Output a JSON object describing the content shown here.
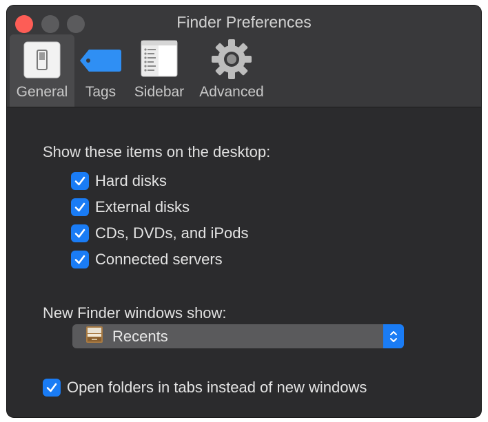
{
  "window": {
    "title": "Finder Preferences"
  },
  "toolbar": {
    "tabs": [
      {
        "label": "General",
        "icon": "general-switch-icon",
        "selected": true
      },
      {
        "label": "Tags",
        "icon": "tag-icon",
        "selected": false
      },
      {
        "label": "Sidebar",
        "icon": "sidebar-list-icon",
        "selected": false
      },
      {
        "label": "Advanced",
        "icon": "gear-icon",
        "selected": false
      }
    ]
  },
  "general": {
    "desktop_heading": "Show these items on the desktop:",
    "desktop_items": [
      {
        "label": "Hard disks",
        "checked": true
      },
      {
        "label": "External disks",
        "checked": true
      },
      {
        "label": "CDs, DVDs, and iPods",
        "checked": true
      },
      {
        "label": "Connected servers",
        "checked": true
      }
    ],
    "new_window_heading": "New Finder windows show:",
    "new_window_value": "Recents",
    "new_window_icon": "recents-drawer-icon",
    "open_in_tabs": {
      "label": "Open folders in tabs instead of new windows",
      "checked": true
    }
  },
  "colors": {
    "accent": "#1a7cf5",
    "close": "#fd5d56",
    "window_bg": "#2b2b2d",
    "toolbar_bg": "#39393b"
  }
}
